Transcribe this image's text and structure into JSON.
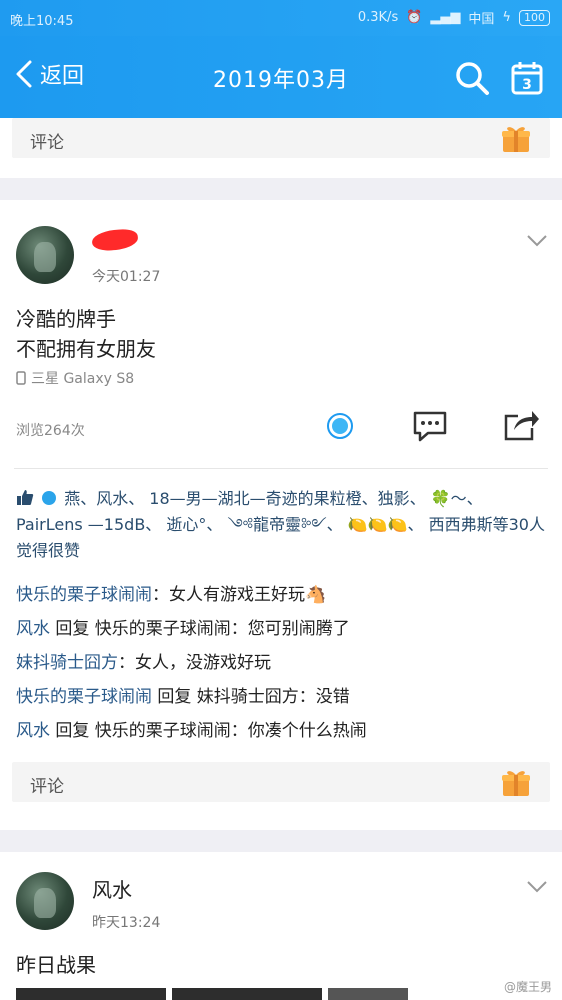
{
  "status_bar": {
    "time": "晚上10:45",
    "network": "0.3K/s",
    "carrier": "中国",
    "battery": "100"
  },
  "nav": {
    "back_label": "返回",
    "title": "2019年03月"
  },
  "top_comment_bar": {
    "label": "评论"
  },
  "post1": {
    "time": "今天01:27",
    "text_line1": "冷酷的牌手",
    "text_line2": "不配拥有女朋友",
    "device": "三星 Galaxy S8",
    "views": "浏览264次",
    "likes_text": "燕、风水、 18—男—湖北—奇迹的果粒橙、独影、 🍀～、PairLens —15dB、 逝心°、 ༺龍帝靈༻、 🍋🍋🍋、 西西弗斯等30人觉得很赞",
    "comments": [
      {
        "name": "快乐的栗子球闹闹",
        "text": "：女人有游戏王好玩🐴"
      },
      {
        "name": "风水",
        "text": " 回复 快乐的栗子球闹闹：您可别闹腾了"
      },
      {
        "name": "妹抖骑士囧方",
        "text": "：女人，没游戏好玩"
      },
      {
        "name": "快乐的栗子球闹闹",
        "text": " 回复 妹抖骑士囧方：没错"
      },
      {
        "name": "风水",
        "text": " 回复 快乐的栗子球闹闹：你凑个什么热闹"
      }
    ],
    "comment_bar_label": "评论"
  },
  "post2": {
    "username": "风水",
    "time": "昨天13:24",
    "text": "昨日战果"
  },
  "watermark": "@魔王男",
  "colors": {
    "accent": "#1d9af0",
    "link": "#2a5a8a",
    "background": "#efeff4"
  }
}
